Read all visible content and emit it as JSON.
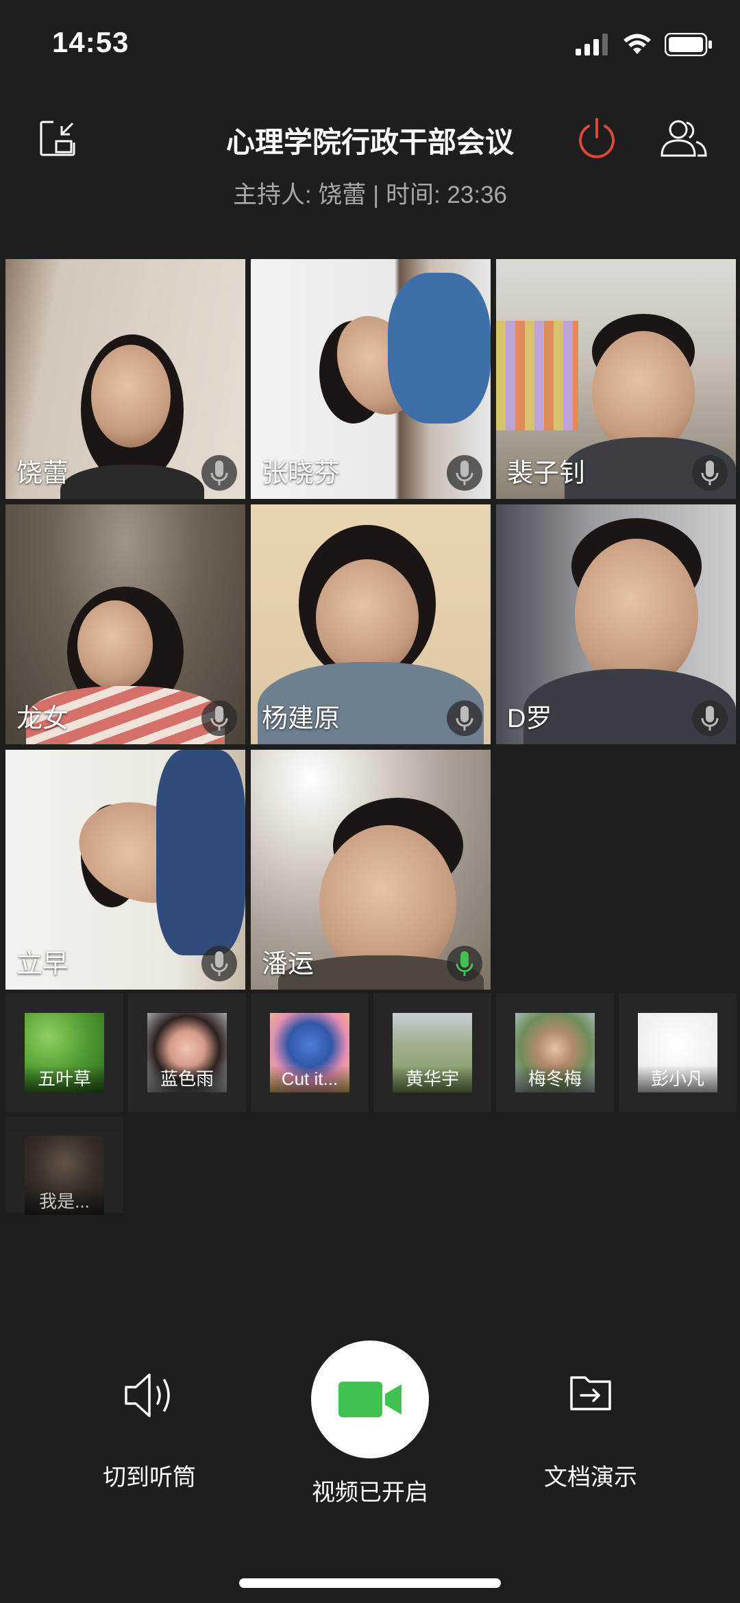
{
  "status_bar": {
    "time": "14:53"
  },
  "meeting": {
    "title": "心理学院行政干部会议",
    "subtitle": "主持人: 饶蕾 | 时间: 23:36"
  },
  "video_participants": [
    {
      "name": "饶蕾",
      "mic": "muted"
    },
    {
      "name": "张晓芬",
      "mic": "muted"
    },
    {
      "name": "裴子钊",
      "mic": "muted"
    },
    {
      "name": "龙女",
      "mic": "muted"
    },
    {
      "name": "杨建原",
      "mic": "muted"
    },
    {
      "name": "D罗",
      "mic": "muted"
    },
    {
      "name": "立早",
      "mic": "muted"
    },
    {
      "name": "潘运",
      "mic": "speaking"
    }
  ],
  "audio_participants": [
    {
      "name": "五叶草"
    },
    {
      "name": "蓝色雨"
    },
    {
      "name": "Cut it..."
    },
    {
      "name": "黄华宇"
    },
    {
      "name": "梅冬梅"
    },
    {
      "name": "彭小凡"
    },
    {
      "name": "我是..."
    }
  ],
  "controls": {
    "speaker_label": "切到听筒",
    "video_label": "视频已开启",
    "share_label": "文档演示"
  },
  "colors": {
    "background": "#1e1e1e",
    "hangup": "#e0463c",
    "mic_active": "#3fc24f",
    "video_icon": "#3fc24f"
  },
  "icons": {
    "minimize": "minimize-window-icon",
    "hangup": "power-icon",
    "members": "members-icon",
    "mic": "microphone-icon",
    "speaker": "speaker-icon",
    "video": "video-camera-icon",
    "share": "share-document-icon"
  }
}
